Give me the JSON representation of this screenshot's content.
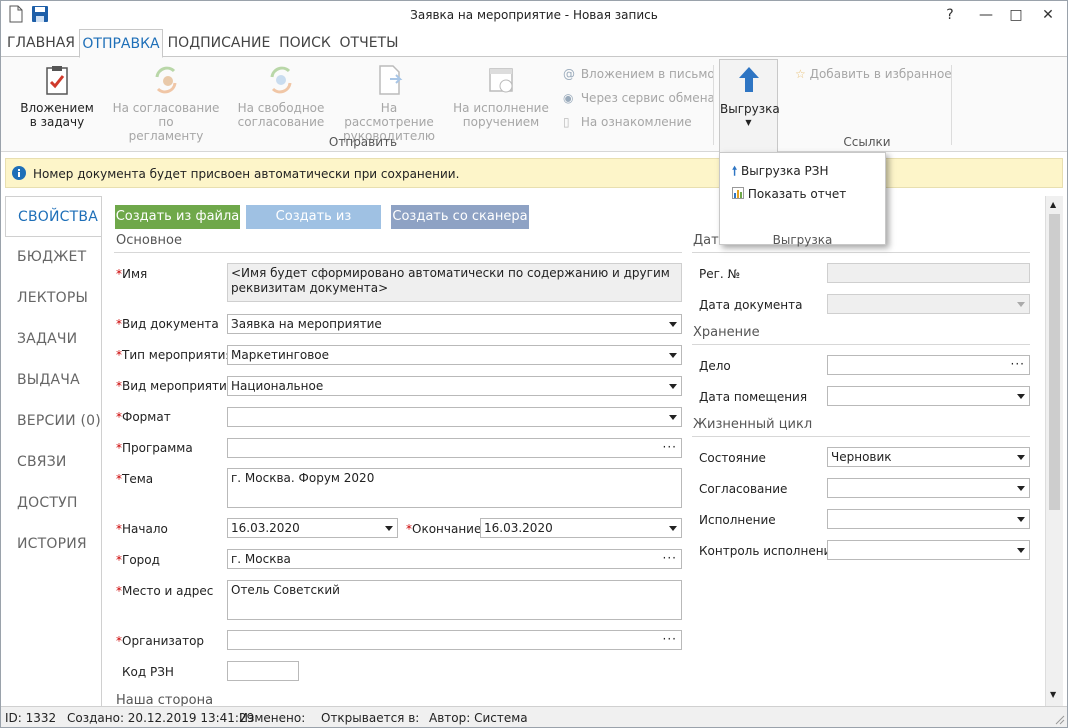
{
  "window": {
    "title": "Заявка на мероприятие - Новая запись",
    "help": "?",
    "minimize": "—",
    "maximize": "□",
    "close": "✕"
  },
  "menu": [
    "ГЛАВНАЯ",
    "ОТПРАВКА",
    "ПОДПИСАНИЕ",
    "ПОИСК",
    "ОТЧЕТЫ"
  ],
  "ribbon": {
    "attach_task": [
      "Вложением",
      "в задачу"
    ],
    "approval_reg": [
      "На согласование по",
      "регламенту"
    ],
    "approval_free": [
      "На свободное",
      "согласование"
    ],
    "review": [
      "На рассмотрение",
      "руководителю"
    ],
    "execute": [
      "На исполнение",
      "поручением"
    ],
    "group_send": "Отправить",
    "attach_mail": "Вложением в письмо",
    "exchange": "Через сервис обмена",
    "familiar": "На ознакомление",
    "export": "Выгрузка",
    "favorite": "Добавить в избранное",
    "group_links": "Ссылки"
  },
  "dropdown": {
    "item1": "Выгрузка РЗН",
    "item2": "Показать отчет",
    "group": "Выгрузка"
  },
  "info": "Номер документа будет присвоен автоматически при сохранении.",
  "nav": [
    "СВОЙСТВА",
    "БЮДЖЕТ",
    "ЛЕКТОРЫ",
    "ЗАДАЧИ",
    "ВЫДАЧА",
    "ВЕРСИИ (0)",
    "СВЯЗИ",
    "ДОСТУП",
    "ИСТОРИЯ"
  ],
  "create": {
    "file": "Создать из файла",
    "template": "Создать из шаблона",
    "scanner": "Создать со сканера"
  },
  "colors": {
    "file": "#6fa84a",
    "template": "#9fc1e3",
    "scanner": "#8ea2c4",
    "accent": "#1e6fb8"
  },
  "form": {
    "section_main": "Основное",
    "name_label": "Имя",
    "name_value": "<Имя будет сформировано автоматически по содержанию и другим реквизитам документа>",
    "doctype_label": "Вид документа",
    "doctype_value": "Заявка на мероприятие",
    "eventtype_label": "Тип мероприятия",
    "eventtype_value": "Маркетинговое",
    "eventkind_label": "Вид мероприятия",
    "eventkind_value": "Национальное",
    "format_label": "Формат",
    "format_value": "",
    "program_label": "Программа",
    "program_value": "",
    "topic_label": "Тема",
    "topic_value": "г. Москва. Форум 2020",
    "start_label": "Начало",
    "start_value": "16.03.2020",
    "end_label": "Окончание",
    "end_value": "16.03.2020",
    "city_label": "Город",
    "city_value": "г. Москва",
    "place_label": "Место и адрес",
    "place_value": "Отель Советский",
    "org_label": "Организатор",
    "org_value": "",
    "rzn_label": "Код РЗН",
    "rzn_value": "",
    "section_side": "Наша сторона",
    "section_data": "Дата",
    "regno_label": "Рег. №",
    "docdate_label": "Дата документа",
    "section_storage": "Хранение",
    "case_label": "Дело",
    "placedate_label": "Дата помещения",
    "section_life": "Жизненный цикл",
    "state_label": "Состояние",
    "state_value": "Черновик",
    "approval_label": "Согласование",
    "exec_label": "Исполнение",
    "control_label": "Контроль исполнения"
  },
  "status": {
    "id": "ID: 1332",
    "created": "Создано: 20.12.2019 13:41:29",
    "changed": "Изменено:",
    "opened": "Открывается в:",
    "author": "Автор: Система"
  }
}
